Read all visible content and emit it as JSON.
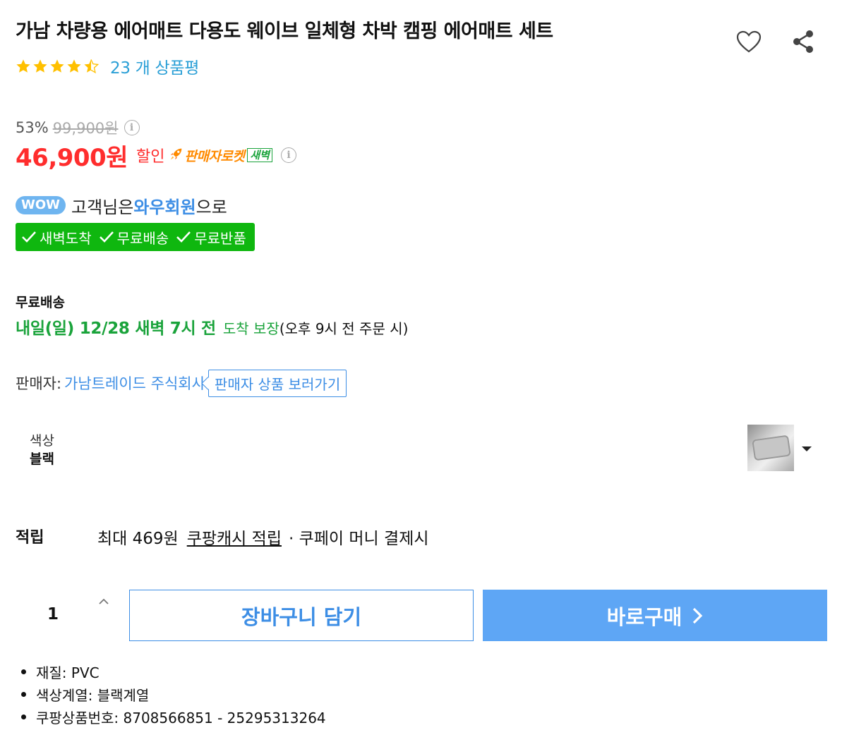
{
  "product": {
    "title": "가남 차량용 에어매트 다용도 웨이브 일체형 차박 캠핑 에어매트 세트",
    "rating": 4.5,
    "review_count_text": "23 개 상품평"
  },
  "price": {
    "discount_rate": "53%",
    "original_price": "99,900원",
    "sale_price": "46,900원",
    "sale_label": "할인",
    "seller_rocket_label": "판매자로켓",
    "dawn_badge": "새벽"
  },
  "wow": {
    "badge": "WOW",
    "text_before": "고객님은",
    "member": "와우회원",
    "text_after": "으로"
  },
  "benefits": {
    "items": [
      "새벽도착",
      "무료배송",
      "무료반품"
    ]
  },
  "shipping": {
    "label": "무료배송",
    "date": "내일(일) 12/28 새벽 7시 전",
    "guarantee": "도착 보장",
    "condition": "(오후 9시 전 주문 시)"
  },
  "seller": {
    "label": "판매자:",
    "name": "가남트레이드 주식회사",
    "button": "판매자 상품 보러가기"
  },
  "option": {
    "label": "색상",
    "value": "블랙"
  },
  "reward": {
    "label": "적립",
    "amount_text": "최대 469원",
    "link": "쿠팡캐시 적립",
    "tail": "· 쿠페이 머니 결제시"
  },
  "purchase": {
    "quantity": "1",
    "cart_button": "장바구니 담기",
    "buy_button": "바로구매"
  },
  "attributes": [
    "재질: PVC",
    "색상계열: 블랙계열",
    "쿠팡상품번호: 8708566851 - 25295313264"
  ],
  "colors": {
    "sale_red": "#ff2d2d",
    "link_blue": "#3d8ee5",
    "benefit_green": "#0fb70f",
    "buy_blue": "#5ea6f5",
    "star_yellow": "#ffc000"
  },
  "icons": [
    "heart-icon",
    "share-icon",
    "star-icon",
    "info-icon",
    "rocket-icon",
    "check-icon",
    "caret-down-icon",
    "chevron-up-icon",
    "chevron-right-icon"
  ]
}
